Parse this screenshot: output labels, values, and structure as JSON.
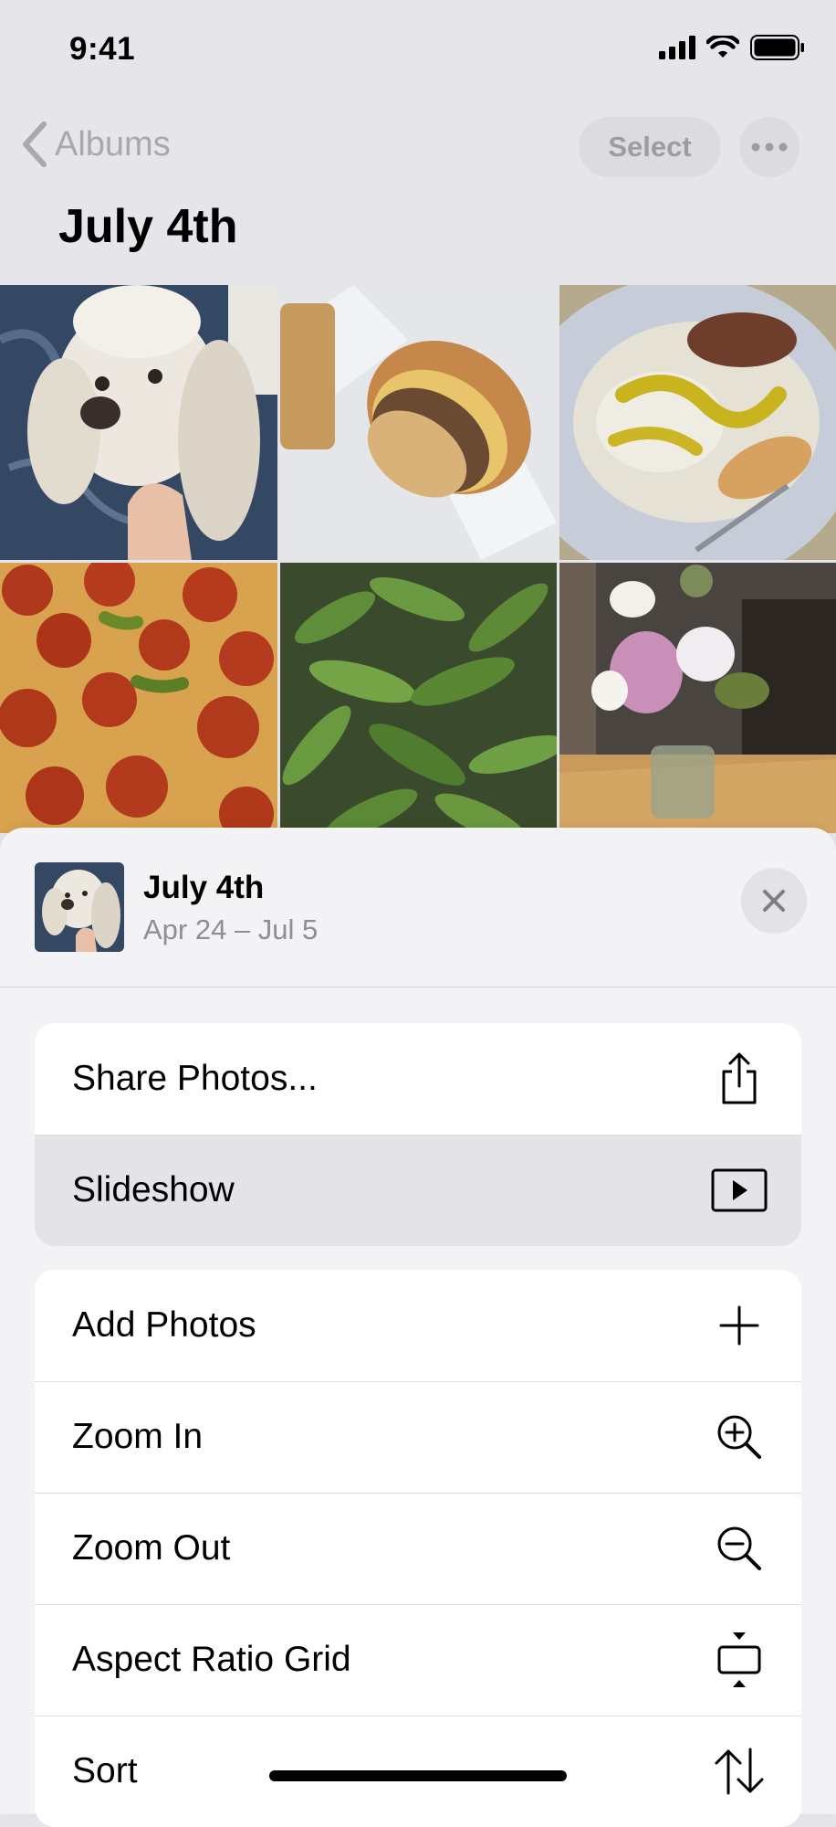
{
  "status_bar": {
    "time": "9:41",
    "icons": [
      "cellular-signal-icon",
      "wifi-icon",
      "battery-icon"
    ]
  },
  "nav": {
    "back_label": "Albums",
    "select_label": "Select",
    "more_icon": "ellipsis-icon"
  },
  "page_title": "July 4th",
  "photos": [
    {
      "subject": "dog"
    },
    {
      "subject": "sandwich"
    },
    {
      "subject": "plate of food"
    },
    {
      "subject": "pizza"
    },
    {
      "subject": "plant"
    },
    {
      "subject": "flowers"
    }
  ],
  "sheet": {
    "album_title": "July 4th",
    "album_dates": "Apr 24 – Jul 5",
    "close_icon": "close-icon",
    "group1": [
      {
        "label": "Share Photos...",
        "icon": "share-icon"
      },
      {
        "label": "Slideshow",
        "icon": "play-icon",
        "highlighted": true
      }
    ],
    "group2": [
      {
        "label": "Add Photos",
        "icon": "plus-icon"
      },
      {
        "label": "Zoom In",
        "icon": "zoom-in-icon"
      },
      {
        "label": "Zoom Out",
        "icon": "zoom-out-icon"
      },
      {
        "label": "Aspect Ratio Grid",
        "icon": "aspect-ratio-icon"
      },
      {
        "label": "Sort",
        "icon": "sort-icon"
      }
    ]
  },
  "colors": {
    "background": "#e6e5ea",
    "sheet": "#f3f2f5",
    "menu_bg": "#ffffff",
    "highlight": "#e4e3e8",
    "secondary_text": "#8e8e93"
  }
}
